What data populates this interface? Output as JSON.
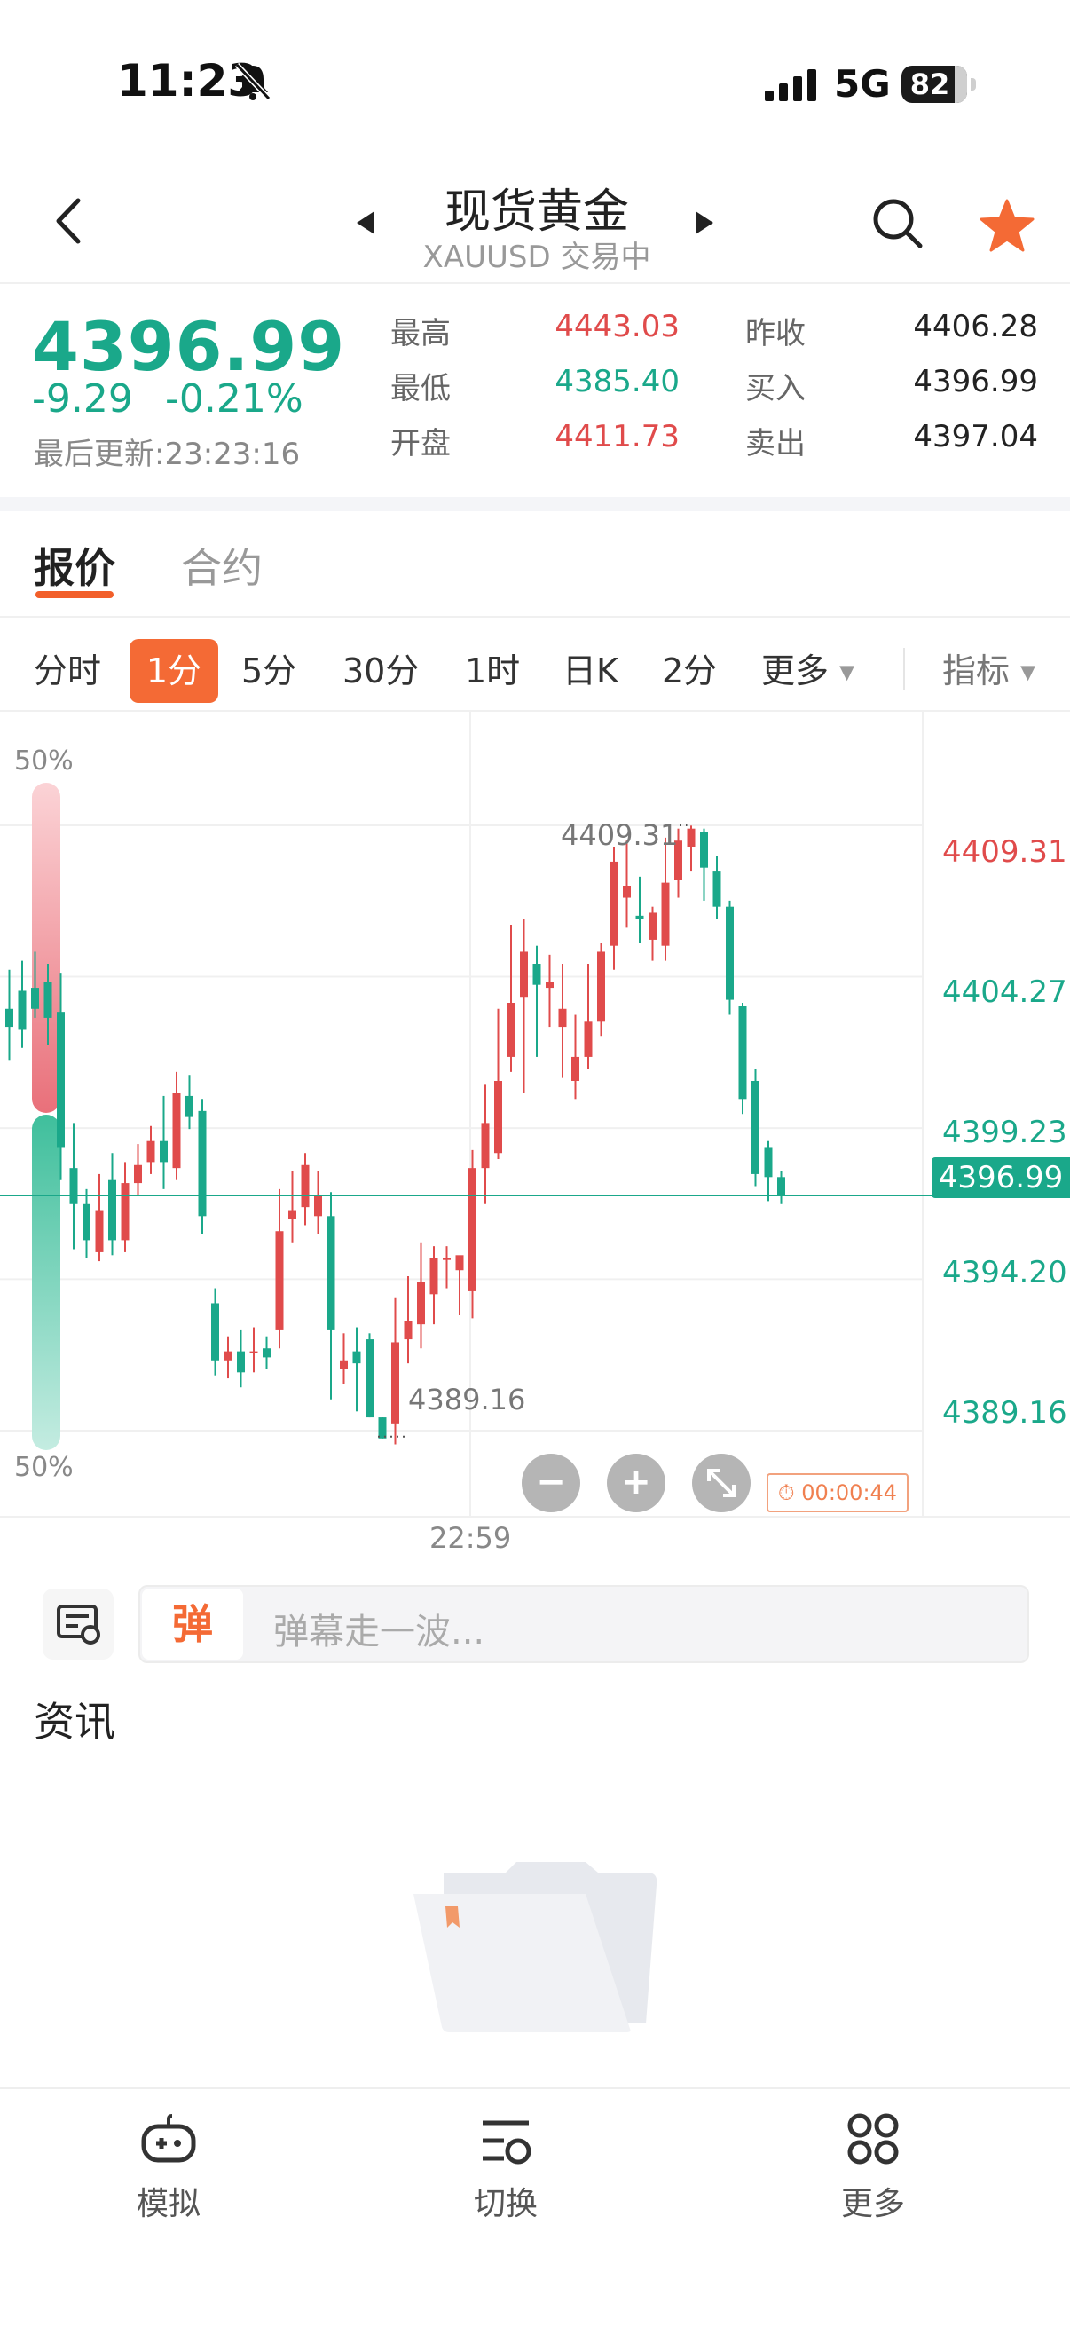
{
  "status_bar": {
    "time": "11:23",
    "network": "5G",
    "battery": "82"
  },
  "header": {
    "title": "现货黄金",
    "subtitle": "XAUUSD 交易中"
  },
  "quote": {
    "price": "4396.99",
    "change": "-9.29",
    "change_pct": "-0.21%",
    "last_update": "最后更新:23:23:16",
    "stats": [
      {
        "label": "最高",
        "value": "4443.03"
      },
      {
        "label": "最低",
        "value": "4385.40"
      },
      {
        "label": "开盘",
        "value": "4411.73"
      },
      {
        "label": "昨收",
        "value": "4406.28"
      },
      {
        "label": "买入",
        "value": "4396.99"
      },
      {
        "label": "卖出",
        "value": "4397.04"
      }
    ]
  },
  "tabs": {
    "quote": "报价",
    "contract": "合约"
  },
  "periods": {
    "p0": "分时",
    "p1": "1分",
    "p2": "5分",
    "p3": "30分",
    "p4": "1时",
    "p5": "日K",
    "p6": "2分",
    "more": "更多",
    "indicator": "指标"
  },
  "chart": {
    "pct_top": "50%",
    "pct_bottom": "50%",
    "y_labels": [
      "4409.31",
      "4404.27",
      "4399.23",
      "4394.20",
      "4389.16"
    ],
    "current_price": "4396.99",
    "max_label": "4409.31",
    "min_label": "4389.16",
    "x_label": "22:59",
    "timer": "00:00:44",
    "ctrl_minus": "−",
    "ctrl_plus": "+"
  },
  "chart_data": {
    "type": "candlestick",
    "x_label": "22:59",
    "y_range": [
      4386.5,
      4412.5
    ],
    "price_line": 4396.99,
    "high_marker": 4409.31,
    "low_marker": 4389.16,
    "candles": [
      [
        4403.2,
        4404.5,
        4402.6,
        4401.5
      ],
      [
        4403.8,
        4404.8,
        4402.5,
        4401.9
      ],
      [
        4403.9,
        4405.1,
        4403.2,
        4402.9
      ],
      [
        4404.1,
        4404.7,
        4402.9,
        4402.0
      ],
      [
        4403.1,
        4404.4,
        4398.6,
        4397.5
      ],
      [
        4397.9,
        4399.4,
        4396.7,
        4395.2
      ],
      [
        4396.7,
        4397.2,
        4395.5,
        4394.9
      ],
      [
        4395.1,
        4397.7,
        4396.5,
        4394.8
      ],
      [
        4397.5,
        4398.4,
        4395.5,
        4395.0
      ],
      [
        4395.5,
        4398.1,
        4397.4,
        4395.1
      ],
      [
        4397.4,
        4398.7,
        4398.0,
        4397.0
      ],
      [
        4398.1,
        4399.3,
        4398.8,
        4397.7
      ],
      [
        4398.8,
        4400.3,
        4398.1,
        4397.2
      ],
      [
        4397.9,
        4401.1,
        4400.4,
        4397.5
      ],
      [
        4400.3,
        4401.0,
        4399.6,
        4399.2
      ],
      [
        4399.8,
        4400.2,
        4396.3,
        4395.7
      ],
      [
        4393.4,
        4393.9,
        4391.5,
        4391.0
      ],
      [
        4391.5,
        4392.3,
        4391.8,
        4390.9
      ],
      [
        4391.8,
        4392.5,
        4391.1,
        4390.6
      ],
      [
        4391.8,
        4392.6,
        4391.8,
        4391.1
      ],
      [
        4391.9,
        4392.3,
        4391.6,
        4391.2
      ],
      [
        4392.5,
        4397.2,
        4395.8,
        4391.9
      ],
      [
        4396.2,
        4397.8,
        4396.5,
        4395.4
      ],
      [
        4396.6,
        4398.4,
        4398.0,
        4396.0
      ],
      [
        4396.3,
        4397.8,
        4397.0,
        4395.7
      ],
      [
        4396.3,
        4397.1,
        4392.5,
        4390.2
      ],
      [
        4391.2,
        4392.4,
        4391.5,
        4390.7
      ],
      [
        4391.8,
        4392.6,
        4391.4,
        4389.8
      ],
      [
        4392.2,
        4392.4,
        4389.6,
        4389.6
      ],
      [
        4389.6,
        4389.6,
        4388.9,
        4388.9
      ],
      [
        4389.4,
        4393.6,
        4392.1,
        4388.7
      ],
      [
        4392.2,
        4394.3,
        4392.8,
        4391.4
      ],
      [
        4392.7,
        4395.4,
        4394.1,
        4391.9
      ],
      [
        4393.7,
        4395.3,
        4394.9,
        4392.7
      ],
      [
        4394.9,
        4395.3,
        4394.9,
        4393.9
      ],
      [
        4394.5,
        4394.9,
        4395.0,
        4393.0
      ],
      [
        4393.8,
        4398.5,
        4397.9,
        4392.9
      ],
      [
        4397.9,
        4400.7,
        4399.4,
        4396.7
      ],
      [
        4398.4,
        4403.2,
        4400.8,
        4398.2
      ],
      [
        4401.6,
        4406.0,
        4403.4,
        4401.1
      ],
      [
        4403.6,
        4406.2,
        4405.1,
        4400.4
      ],
      [
        4404.7,
        4405.3,
        4404.0,
        4401.6
      ],
      [
        4403.9,
        4405.0,
        4404.1,
        4402.6
      ],
      [
        4402.6,
        4404.7,
        4403.2,
        4400.9
      ],
      [
        4400.8,
        4403.0,
        4401.6,
        4400.2
      ],
      [
        4401.6,
        4404.7,
        4402.8,
        4401.2
      ],
      [
        4402.8,
        4405.4,
        4405.1,
        4402.3
      ],
      [
        4405.3,
        4408.6,
        4408.1,
        4404.5
      ],
      [
        4406.9,
        4408.8,
        4407.3,
        4405.9
      ],
      [
        4406.3,
        4407.6,
        4406.2,
        4405.4
      ],
      [
        4405.5,
        4406.6,
        4406.4,
        4404.8
      ],
      [
        4405.3,
        4408.9,
        4407.4,
        4404.8
      ],
      [
        4407.5,
        4409.2,
        4408.8,
        4406.9
      ],
      [
        4408.6,
        4409.3,
        4409.2,
        4407.8
      ],
      [
        4409.1,
        4409.2,
        4407.9,
        4406.8
      ],
      [
        4407.8,
        4408.3,
        4406.6,
        4406.2
      ],
      [
        4406.6,
        4406.8,
        4403.5,
        4403.0
      ],
      [
        4403.3,
        4403.4,
        4400.2,
        4399.7
      ],
      [
        4400.8,
        4401.2,
        4397.7,
        4397.3
      ],
      [
        4398.6,
        4398.8,
        4397.6,
        4396.8
      ],
      [
        4397.6,
        4397.8,
        4396.99,
        4396.7
      ]
    ]
  },
  "danmaku": {
    "badge": "弹",
    "placeholder": "弹幕走一波..."
  },
  "news": {
    "title": "资讯"
  },
  "bottom_nav": {
    "simulate": "模拟",
    "switch": "切换",
    "more": "更多"
  },
  "colors": {
    "up": "#e04b4b",
    "down": "#1aa88a",
    "accent": "#f46a35"
  }
}
